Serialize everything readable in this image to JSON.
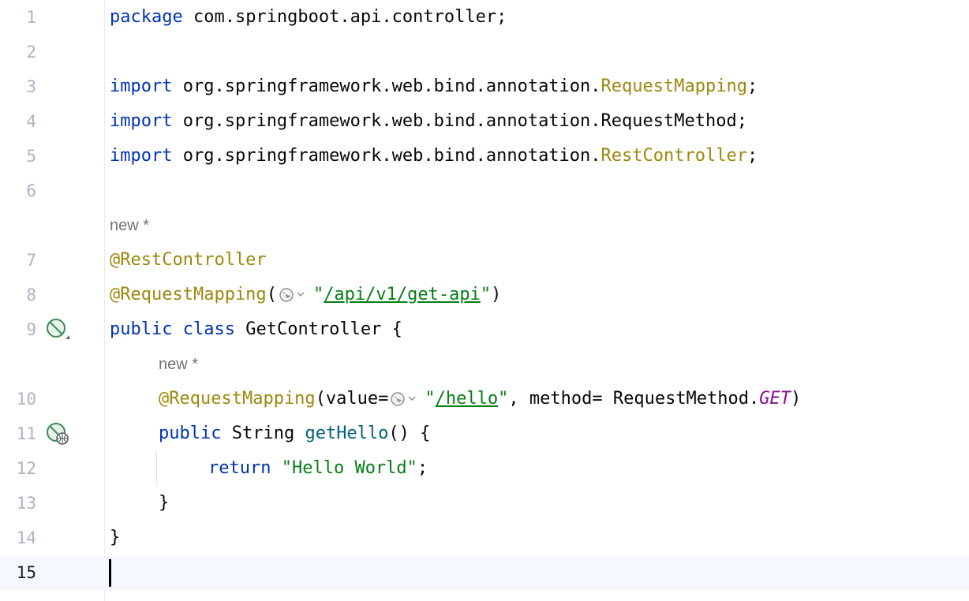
{
  "editor": {
    "language": "java",
    "current_line": "15",
    "colors": {
      "keyword": "#0033b3",
      "annotation": "#9e880d",
      "string": "#067d17",
      "method": "#00627a",
      "constant": "#871094",
      "line_number": "#aeb3c2",
      "hint": "#6f737a"
    },
    "lines": {
      "l1": {
        "num": "1",
        "kw": "package",
        "rest": " com.springboot.api.controller;"
      },
      "l2": {
        "num": "2"
      },
      "l3": {
        "num": "3",
        "kw": "import",
        "pkg": " org.springframework.web.bind.annotation.",
        "cls": "RequestMapping",
        "end": ";"
      },
      "l4": {
        "num": "4",
        "kw": "import",
        "rest": " org.springframework.web.bind.annotation.RequestMethod;"
      },
      "l5": {
        "num": "5",
        "kw": "import",
        "pkg": " org.springframework.web.bind.annotation.",
        "cls": "RestController",
        "end": ";"
      },
      "l6": {
        "num": "6"
      },
      "hint1": {
        "text": "new *"
      },
      "l7": {
        "num": "7",
        "ann": "@RestController"
      },
      "l8": {
        "num": "8",
        "ann": "@RequestMapping",
        "open": "(",
        "q1": "\"",
        "url": "/api/v1/get-api",
        "q2": "\"",
        "close": ")"
      },
      "l9": {
        "num": "9",
        "kw1": "public",
        "kw2": "class",
        "rest": " GetController {"
      },
      "hint2": {
        "text": "new *"
      },
      "l10": {
        "num": "10",
        "ann": "@RequestMapping",
        "open": "(value=",
        "q1": "\"",
        "url": "/hello",
        "q2": "\"",
        "mid": ", method= RequestMethod.",
        "const": "GET",
        "close": ")"
      },
      "l11": {
        "num": "11",
        "kw": "public",
        "type": " String ",
        "fn": "getHello",
        "rest": "() {"
      },
      "l12": {
        "num": "12",
        "kw": "return",
        "str": "\"Hello World\"",
        "end": ";"
      },
      "l13": {
        "num": "13",
        "text": "}"
      },
      "l14": {
        "num": "14",
        "text": "}"
      },
      "l15": {
        "num": "15"
      }
    },
    "gutter_icons": {
      "line9": "bean-class-icon",
      "line11": "web-endpoint-icon"
    }
  }
}
